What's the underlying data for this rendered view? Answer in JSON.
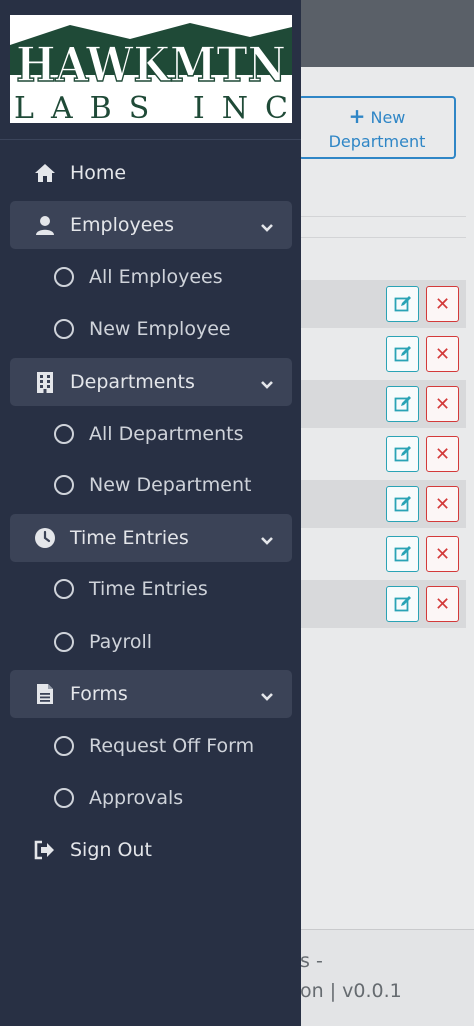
{
  "logo": {
    "line1": "HAWKMTN",
    "line2": "LABS INC"
  },
  "new_department_button": {
    "label_line1": "New",
    "label_line2": "Department"
  },
  "footer": {
    "line1": "s -",
    "line2": "on | v0.0.1"
  },
  "sidebar": {
    "home": {
      "label": "Home",
      "icon": "home-icon"
    },
    "employees": {
      "label": "Employees",
      "icon": "user-icon",
      "items": [
        "All Employees",
        "New Employee"
      ]
    },
    "departments": {
      "label": "Departments",
      "icon": "building-icon",
      "items": [
        "All Departments",
        "New Department"
      ]
    },
    "time_entries": {
      "label": "Time Entries",
      "icon": "clock-icon",
      "items": [
        "Time Entries",
        "Payroll"
      ]
    },
    "forms": {
      "label": "Forms",
      "icon": "document-icon",
      "items": [
        "Request Off Form",
        "Approvals"
      ]
    },
    "sign_out": {
      "label": "Sign Out",
      "icon": "sign-out-icon"
    }
  },
  "colors": {
    "sidebar_bg": "#283044",
    "section_bg": "#3b4357",
    "accent_blue": "#2f86c6",
    "edit_teal": "#2aa3b5",
    "delete_red": "#d33a3a",
    "logo_green": "#1f4a37"
  }
}
